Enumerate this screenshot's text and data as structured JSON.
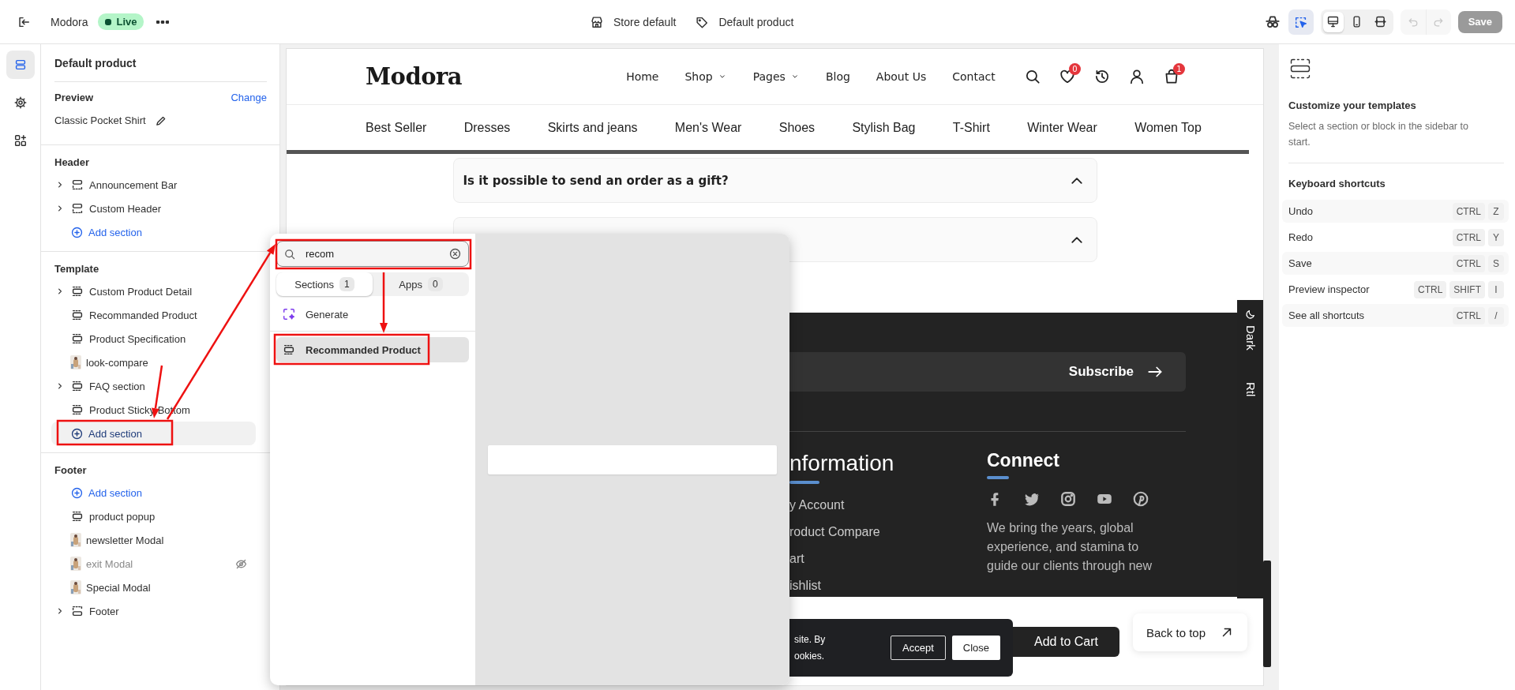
{
  "top_bar": {
    "store_name": "Modora",
    "status": "Live",
    "context": [
      {
        "kind": "store",
        "label": "Store default"
      },
      {
        "kind": "tag",
        "label": "Default product"
      }
    ],
    "inspector": {
      "selected": true
    },
    "devices": [
      {
        "kind": "desktop",
        "selected": true
      },
      {
        "kind": "mobile",
        "selected": false
      },
      {
        "kind": "fullwidth",
        "selected": false
      }
    ],
    "history": [
      {
        "kind": "undo",
        "disabled": true
      },
      {
        "kind": "redo",
        "disabled": true
      }
    ],
    "save": {
      "label": "Save",
      "disabled": true
    }
  },
  "rail": [
    {
      "kind": "sections",
      "selected": true
    },
    {
      "kind": "settings",
      "selected": false
    },
    {
      "kind": "apps",
      "selected": false
    }
  ],
  "sidebar": {
    "title": "Default product",
    "preview": {
      "label": "Preview",
      "action": "Change",
      "value": "Classic Pocket Shirt"
    },
    "groups": [
      {
        "title": "Header",
        "items": [
          {
            "kind": "header",
            "label": "Announcement Bar",
            "expandable": true,
            "hidden": false
          },
          {
            "kind": "header",
            "label": "Custom Header",
            "expandable": true,
            "hidden": false
          },
          {
            "kind": "add",
            "label": "Add section",
            "highlighted": false
          }
        ]
      },
      {
        "title": "Template",
        "items": [
          {
            "kind": "section",
            "label": "Custom Product Detail",
            "expandable": true,
            "hidden": false
          },
          {
            "kind": "section",
            "label": "Recommanded Product",
            "expandable": false,
            "hidden": false
          },
          {
            "kind": "section",
            "label": "Product Specification",
            "expandable": false,
            "hidden": false
          },
          {
            "kind": "thumbnail",
            "label": "look-compare",
            "expandable": false,
            "hidden": false
          },
          {
            "kind": "section",
            "label": "FAQ section",
            "expandable": true,
            "hidden": false
          },
          {
            "kind": "section",
            "label": "Product Sticky Bottom",
            "expandable": false,
            "hidden": false
          },
          {
            "kind": "add",
            "label": "Add section",
            "highlighted": true
          }
        ]
      },
      {
        "title": "Footer",
        "items": [
          {
            "kind": "add",
            "label": "Add section",
            "highlighted": false
          },
          {
            "kind": "section",
            "label": "product popup",
            "expandable": false,
            "hidden": false
          },
          {
            "kind": "thumbnail",
            "label": "newsletter Modal",
            "expandable": false,
            "hidden": false
          },
          {
            "kind": "thumbnail",
            "label": "exit Modal",
            "expandable": false,
            "hidden": true
          },
          {
            "kind": "thumbnail",
            "label": "Special Modal",
            "expandable": false,
            "hidden": false
          },
          {
            "kind": "footer",
            "label": "Footer",
            "expandable": true,
            "hidden": false
          }
        ]
      }
    ]
  },
  "preview": {
    "store": {
      "logo": "Modora",
      "nav": [
        {
          "label": "Home",
          "dropdown": false
        },
        {
          "label": "Shop",
          "dropdown": true
        },
        {
          "label": "Pages",
          "dropdown": true
        },
        {
          "label": "Blog",
          "dropdown": false
        },
        {
          "label": "About Us",
          "dropdown": false
        },
        {
          "label": "Contact",
          "dropdown": false
        }
      ],
      "wishlist_count": "0",
      "cart_count": "1",
      "categories": [
        "Best Seller",
        "Dresses",
        "Skirts and jeans",
        "Men's Wear",
        "Shoes",
        "Stylish Bag",
        "T-Shirt",
        "Winter Wear",
        "Women Top"
      ]
    },
    "faq": [
      {
        "kind": "question",
        "question": "Is it possible to send an order as a gift?"
      },
      {
        "kind": "covered"
      }
    ],
    "footer": {
      "subscribe": "Subscribe",
      "information": {
        "title": "nformation",
        "links": [
          "y Account",
          "roduct Compare",
          "art",
          "ishlist"
        ]
      },
      "connect": {
        "title": "Connect",
        "text": "We bring the years, global experience, and stamina to guide our clients through new"
      },
      "side_tab": [
        "Dark",
        "Rtl"
      ]
    },
    "cookie": {
      "lines": [
        "site. By",
        "ookies."
      ],
      "accept": "Accept",
      "close": "Close"
    },
    "add_to_cart": "Add to Cart",
    "back_to_top": "Back to top"
  },
  "popup": {
    "search": {
      "value": "recom"
    },
    "tabs": [
      {
        "label": "Sections",
        "count": "1",
        "selected": true
      },
      {
        "label": "Apps",
        "count": "0",
        "selected": false
      }
    ],
    "generate": "Generate",
    "results": [
      {
        "label": "Recommanded Product",
        "selected": true
      }
    ]
  },
  "right_panel": {
    "title": "Customize your templates",
    "description": "Select a section or block in the sidebar to start.",
    "shortcuts_title": "Keyboard shortcuts",
    "shortcuts": [
      {
        "action": "Undo",
        "keys": [
          "CTRL",
          "Z"
        ]
      },
      {
        "action": "Redo",
        "keys": [
          "CTRL",
          "Y"
        ]
      },
      {
        "action": "Save",
        "keys": [
          "CTRL",
          "S"
        ]
      },
      {
        "action": "Preview inspector",
        "keys": [
          "CTRL",
          "SHIFT",
          "I"
        ]
      },
      {
        "action": "See all shortcuts",
        "keys": [
          "CTRL",
          "/"
        ]
      }
    ]
  }
}
